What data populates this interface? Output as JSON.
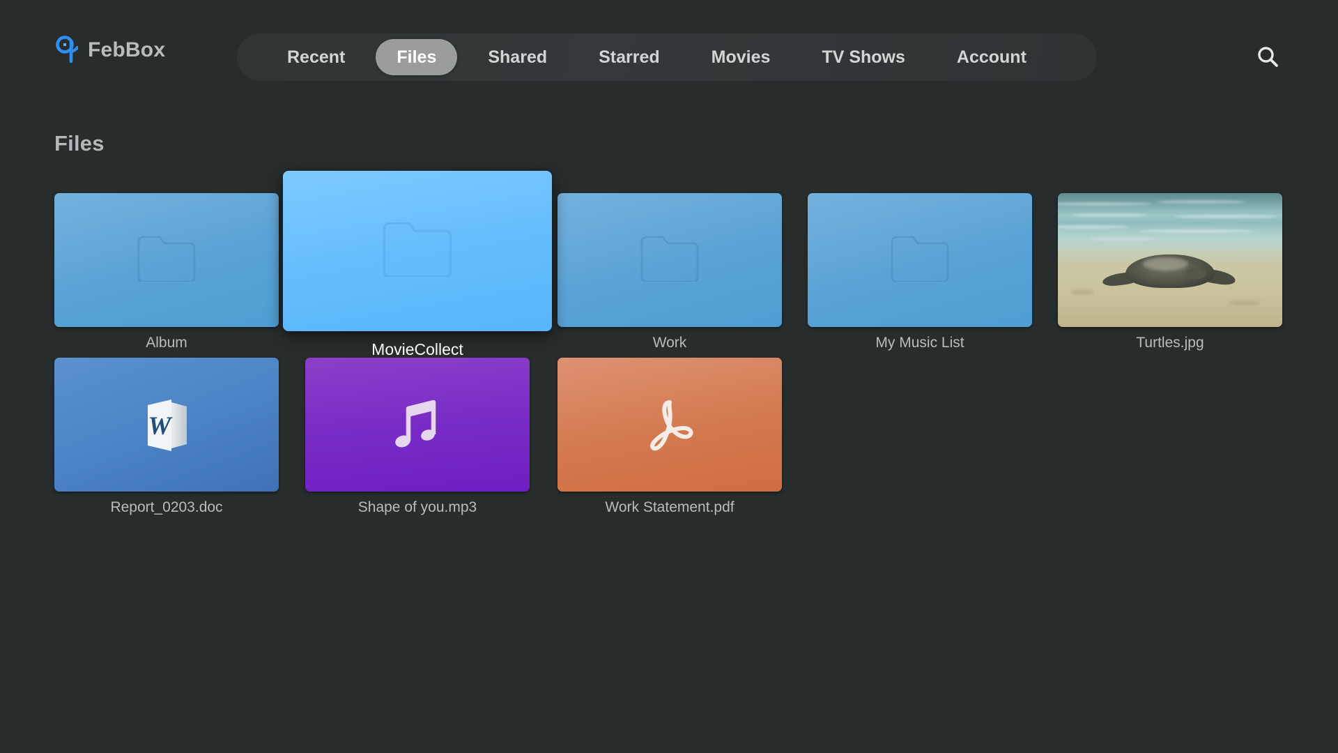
{
  "app": {
    "brand_name": "FebBox",
    "logo_icon": "febbox-logo-icon",
    "background_color": "#272d2d"
  },
  "header": {
    "nav_items": [
      {
        "label": "Recent",
        "active": false
      },
      {
        "label": "Files",
        "active": true
      },
      {
        "label": "Shared",
        "active": false
      },
      {
        "label": "Starred",
        "active": false
      },
      {
        "label": "Movies",
        "active": false
      },
      {
        "label": "TV Shows",
        "active": false
      },
      {
        "label": "Account",
        "active": false
      }
    ],
    "active_tab": "Files",
    "search_icon": "search-icon",
    "active_pill_color": "#9b9c9c"
  },
  "main": {
    "section_title": "Files",
    "rows": [
      {
        "items": [
          {
            "name": "Album",
            "kind": "folder",
            "icon": "folder-icon",
            "selected": false,
            "color": "#5aa3d6"
          },
          {
            "name": "MovieCollect",
            "kind": "folder",
            "icon": "folder-icon",
            "selected": true,
            "color": "#65bdfd"
          },
          {
            "name": "Work",
            "kind": "folder",
            "icon": "folder-icon",
            "selected": false,
            "color": "#5aa3d6"
          },
          {
            "name": "My Music List",
            "kind": "folder",
            "icon": "folder-icon",
            "selected": false,
            "color": "#5aa3d6"
          },
          {
            "name": "Turtles.jpg",
            "kind": "image",
            "icon": "photo-thumbnail",
            "selected": false,
            "color": "#9dc7c7"
          }
        ]
      },
      {
        "items": [
          {
            "name": "Report_0203.doc",
            "kind": "document",
            "icon": "word-document-icon",
            "selected": false,
            "color": "#4b82c4"
          },
          {
            "name": "Shape of you.mp3",
            "kind": "audio",
            "icon": "music-note-icon",
            "selected": false,
            "color": "#7a2ec6"
          },
          {
            "name": "Work Statement.pdf",
            "kind": "pdf",
            "icon": "pdf-acrobat-icon",
            "selected": false,
            "color": "#d4794f"
          }
        ]
      }
    ]
  }
}
